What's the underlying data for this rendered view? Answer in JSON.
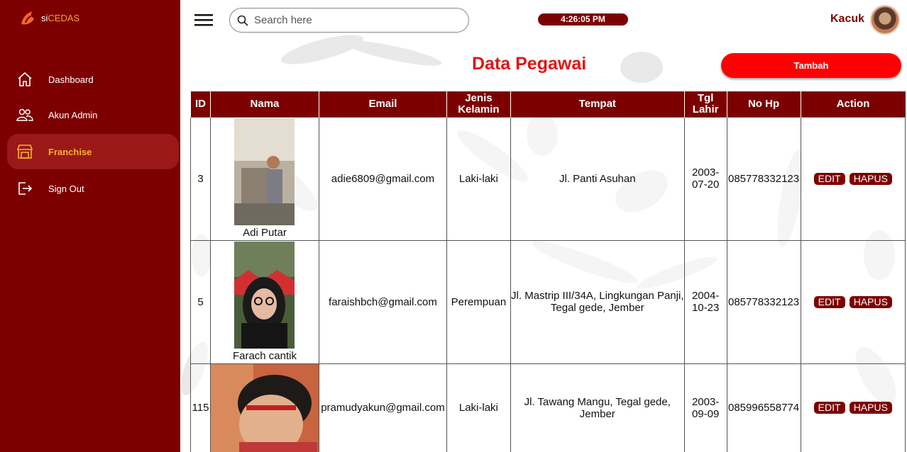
{
  "brand": {
    "prefix": "si",
    "name": "CEDAS"
  },
  "sidebar": {
    "items": [
      {
        "label": "Dashboard",
        "icon": "home-icon",
        "active": false
      },
      {
        "label": "Akun Admin",
        "icon": "users-icon",
        "active": false
      },
      {
        "label": "Franchise",
        "icon": "store-icon",
        "active": true
      },
      {
        "label": "Sign Out",
        "icon": "sign-out-icon",
        "active": false
      }
    ]
  },
  "header": {
    "search_placeholder": "Search here",
    "clock": "4:26:05 PM",
    "user": "Kacuk"
  },
  "main": {
    "title": "Data Pegawai",
    "add_button": "Tambah",
    "columns": [
      "ID",
      "Nama",
      "Email",
      "Jenis Kelamin",
      "Tempat",
      "Tgl Lahir",
      "No Hp",
      "Action"
    ],
    "rows": [
      {
        "id": "3",
        "name": "Adi Putar",
        "email": "adie6809@gmail.com",
        "gender": "Laki-laki",
        "place": "Jl. Panti Asuhan",
        "dob": "2003-07-20",
        "phone": "085778332123",
        "edit": "EDIT",
        "delete": "HAPUS"
      },
      {
        "id": "5",
        "name": "Farach cantik",
        "email": "faraishbch@gmail.com",
        "gender": "Perempuan",
        "place": "Jl. Mastrip III/34A, Lingkungan Panji, Tegal gede, Jember",
        "dob": "2004-10-23",
        "phone": "085778332123",
        "edit": "EDIT",
        "delete": "HAPUS"
      },
      {
        "id": "115",
        "name": "",
        "email": "pramudyakun@gmail.com",
        "gender": "Laki-laki",
        "place": "Jl. Tawang Mangu, Tegal gede, Jember",
        "dob": "2003-09-09",
        "phone": "085996558774",
        "edit": "EDIT",
        "delete": "HAPUS"
      }
    ]
  },
  "colors": {
    "primary": "#7d0000",
    "accent": "#ff0000",
    "active_text": "#f5b42a",
    "title": "#e01515"
  }
}
